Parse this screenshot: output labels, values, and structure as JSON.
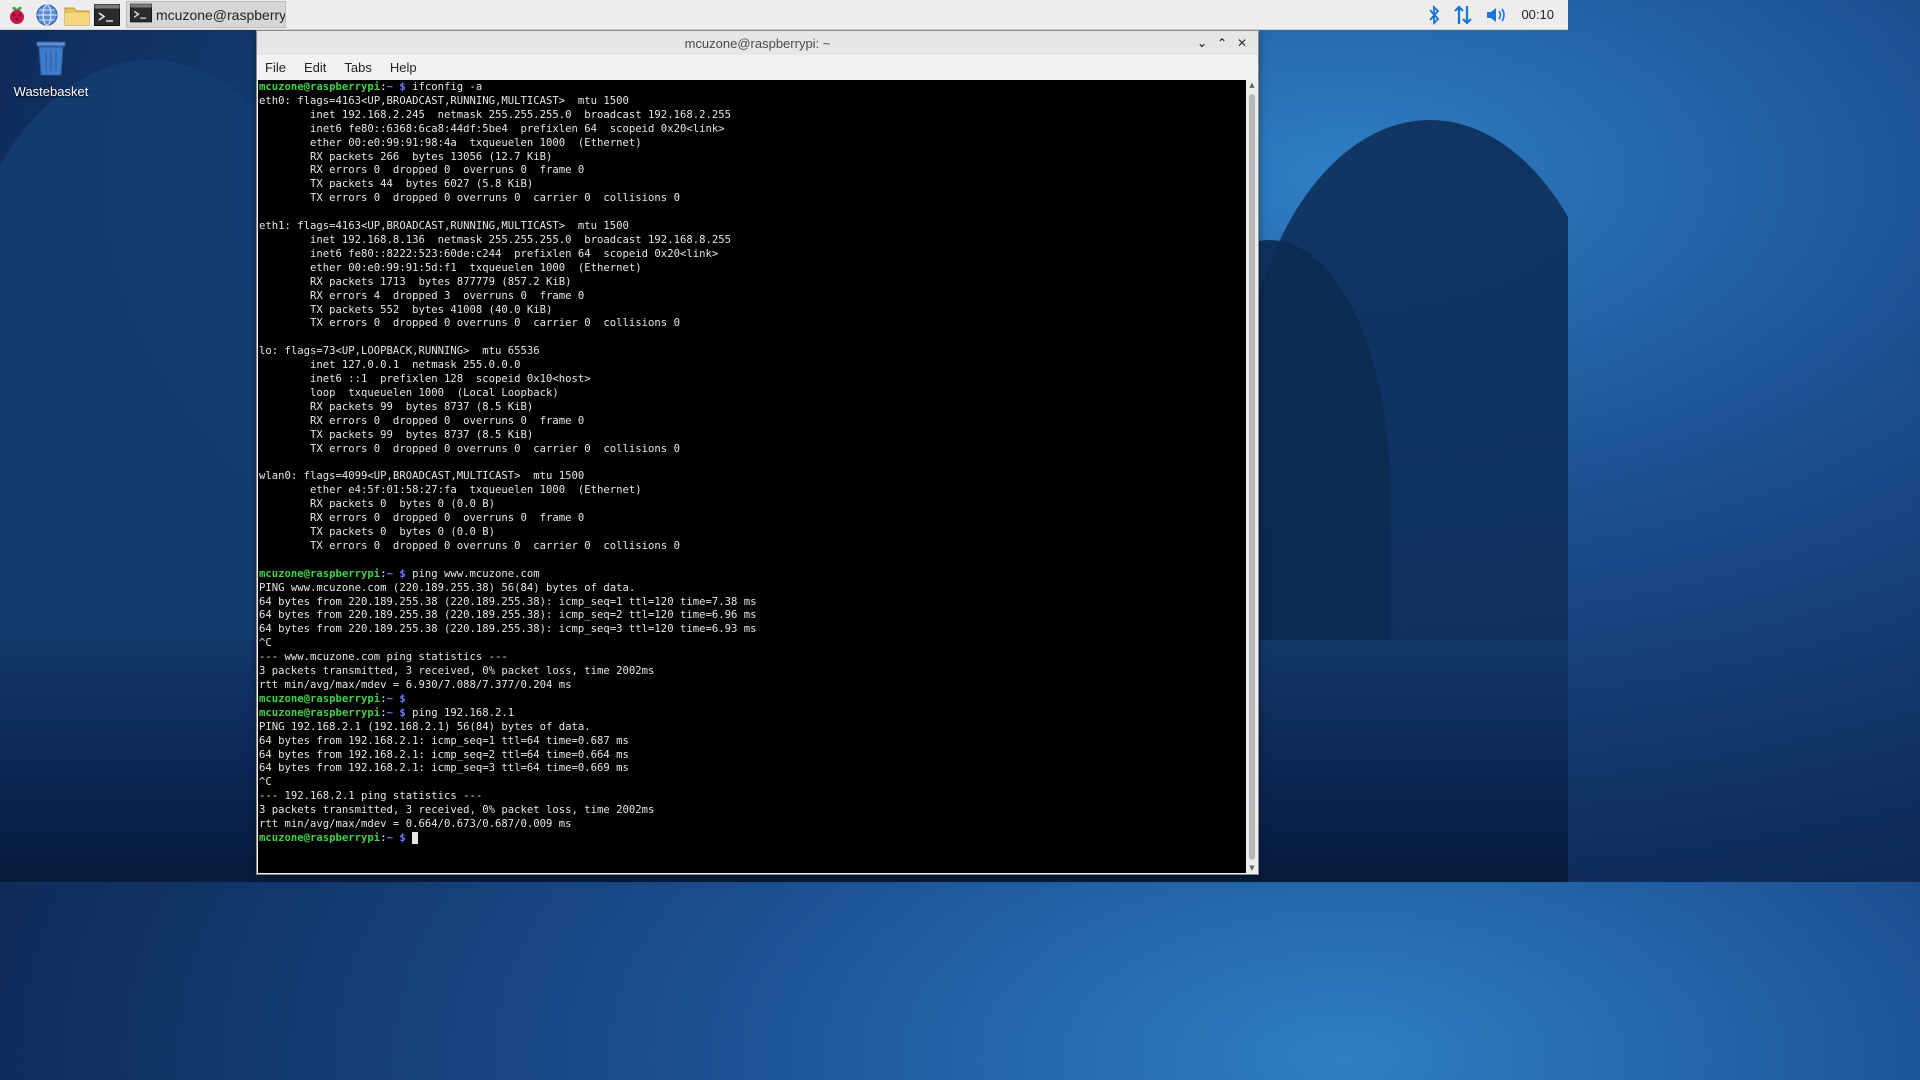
{
  "taskbar": {
    "icons": [
      "raspberry-menu-icon",
      "web-browser-icon",
      "file-manager-icon",
      "terminal-icon"
    ],
    "task_label": "mcuzone@raspberry...",
    "clock": "00:10",
    "tray_icons": [
      "bluetooth-icon",
      "network-arrows-icon",
      "volume-icon"
    ]
  },
  "desktop": {
    "wastebasket_label": "Wastebasket"
  },
  "window": {
    "title": "mcuzone@raspberrypi: ~",
    "menu": [
      "File",
      "Edit",
      "Tabs",
      "Help"
    ],
    "controls": {
      "minimize": "⌄",
      "maximize": "⌃",
      "close": "✕"
    }
  },
  "terminal": {
    "prompt_user": "mcuzone@raspberrypi",
    "prompt_sep": ":",
    "prompt_path": "~ $",
    "lines": [
      {
        "type": "prompt",
        "cmd": " ifconfig -a"
      },
      {
        "type": "out",
        "text": "eth0: flags=4163<UP,BROADCAST,RUNNING,MULTICAST>  mtu 1500"
      },
      {
        "type": "out",
        "text": "        inet 192.168.2.245  netmask 255.255.255.0  broadcast 192.168.2.255"
      },
      {
        "type": "out",
        "text": "        inet6 fe80::6368:6ca8:44df:5be4  prefixlen 64  scopeid 0x20<link>"
      },
      {
        "type": "out",
        "text": "        ether 00:e0:99:91:98:4a  txqueuelen 1000  (Ethernet)"
      },
      {
        "type": "out",
        "text": "        RX packets 266  bytes 13056 (12.7 KiB)"
      },
      {
        "type": "out",
        "text": "        RX errors 0  dropped 0  overruns 0  frame 0"
      },
      {
        "type": "out",
        "text": "        TX packets 44  bytes 6027 (5.8 KiB)"
      },
      {
        "type": "out",
        "text": "        TX errors 0  dropped 0 overruns 0  carrier 0  collisions 0"
      },
      {
        "type": "out",
        "text": ""
      },
      {
        "type": "out",
        "text": "eth1: flags=4163<UP,BROADCAST,RUNNING,MULTICAST>  mtu 1500"
      },
      {
        "type": "out",
        "text": "        inet 192.168.8.136  netmask 255.255.255.0  broadcast 192.168.8.255"
      },
      {
        "type": "out",
        "text": "        inet6 fe80::8222:523:60de:c244  prefixlen 64  scopeid 0x20<link>"
      },
      {
        "type": "out",
        "text": "        ether 00:e0:99:91:5d:f1  txqueuelen 1000  (Ethernet)"
      },
      {
        "type": "out",
        "text": "        RX packets 1713  bytes 877779 (857.2 KiB)"
      },
      {
        "type": "out",
        "text": "        RX errors 4  dropped 3  overruns 0  frame 0"
      },
      {
        "type": "out",
        "text": "        TX packets 552  bytes 41008 (40.0 KiB)"
      },
      {
        "type": "out",
        "text": "        TX errors 0  dropped 0 overruns 0  carrier 0  collisions 0"
      },
      {
        "type": "out",
        "text": ""
      },
      {
        "type": "out",
        "text": "lo: flags=73<UP,LOOPBACK,RUNNING>  mtu 65536"
      },
      {
        "type": "out",
        "text": "        inet 127.0.0.1  netmask 255.0.0.0"
      },
      {
        "type": "out",
        "text": "        inet6 ::1  prefixlen 128  scopeid 0x10<host>"
      },
      {
        "type": "out",
        "text": "        loop  txqueuelen 1000  (Local Loopback)"
      },
      {
        "type": "out",
        "text": "        RX packets 99  bytes 8737 (8.5 KiB)"
      },
      {
        "type": "out",
        "text": "        RX errors 0  dropped 0  overruns 0  frame 0"
      },
      {
        "type": "out",
        "text": "        TX packets 99  bytes 8737 (8.5 KiB)"
      },
      {
        "type": "out",
        "text": "        TX errors 0  dropped 0 overruns 0  carrier 0  collisions 0"
      },
      {
        "type": "out",
        "text": ""
      },
      {
        "type": "out",
        "text": "wlan0: flags=4099<UP,BROADCAST,MULTICAST>  mtu 1500"
      },
      {
        "type": "out",
        "text": "        ether e4:5f:01:58:27:fa  txqueuelen 1000  (Ethernet)"
      },
      {
        "type": "out",
        "text": "        RX packets 0  bytes 0 (0.0 B)"
      },
      {
        "type": "out",
        "text": "        RX errors 0  dropped 0  overruns 0  frame 0"
      },
      {
        "type": "out",
        "text": "        TX packets 0  bytes 0 (0.0 B)"
      },
      {
        "type": "out",
        "text": "        TX errors 0  dropped 0 overruns 0  carrier 0  collisions 0"
      },
      {
        "type": "out",
        "text": ""
      },
      {
        "type": "prompt",
        "cmd": " ping www.mcuzone.com"
      },
      {
        "type": "out",
        "text": "PING www.mcuzone.com (220.189.255.38) 56(84) bytes of data."
      },
      {
        "type": "out",
        "text": "64 bytes from 220.189.255.38 (220.189.255.38): icmp_seq=1 ttl=120 time=7.38 ms"
      },
      {
        "type": "out",
        "text": "64 bytes from 220.189.255.38 (220.189.255.38): icmp_seq=2 ttl=120 time=6.96 ms"
      },
      {
        "type": "out",
        "text": "64 bytes from 220.189.255.38 (220.189.255.38): icmp_seq=3 ttl=120 time=6.93 ms"
      },
      {
        "type": "out",
        "text": "^C"
      },
      {
        "type": "out",
        "text": "--- www.mcuzone.com ping statistics ---"
      },
      {
        "type": "out",
        "text": "3 packets transmitted, 3 received, 0% packet loss, time 2002ms"
      },
      {
        "type": "out",
        "text": "rtt min/avg/max/mdev = 6.930/7.088/7.377/0.204 ms"
      },
      {
        "type": "prompt",
        "cmd": ""
      },
      {
        "type": "prompt",
        "cmd": " ping 192.168.2.1"
      },
      {
        "type": "out",
        "text": "PING 192.168.2.1 (192.168.2.1) 56(84) bytes of data."
      },
      {
        "type": "out",
        "text": "64 bytes from 192.168.2.1: icmp_seq=1 ttl=64 time=0.687 ms"
      },
      {
        "type": "out",
        "text": "64 bytes from 192.168.2.1: icmp_seq=2 ttl=64 time=0.664 ms"
      },
      {
        "type": "out",
        "text": "64 bytes from 192.168.2.1: icmp_seq=3 ttl=64 time=0.669 ms"
      },
      {
        "type": "out",
        "text": "^C"
      },
      {
        "type": "out",
        "text": "--- 192.168.2.1 ping statistics ---"
      },
      {
        "type": "out",
        "text": "3 packets transmitted, 3 received, 0% packet loss, time 2002ms"
      },
      {
        "type": "out",
        "text": "rtt min/avg/max/mdev = 0.664/0.673/0.687/0.009 ms"
      },
      {
        "type": "prompt",
        "cmd": " ",
        "cursor": true
      }
    ]
  },
  "colors": {
    "prompt_user": "#3fd34a",
    "prompt_path": "#6b7cff",
    "terminal_bg": "#000000",
    "terminal_fg": "#e6e6e6"
  }
}
